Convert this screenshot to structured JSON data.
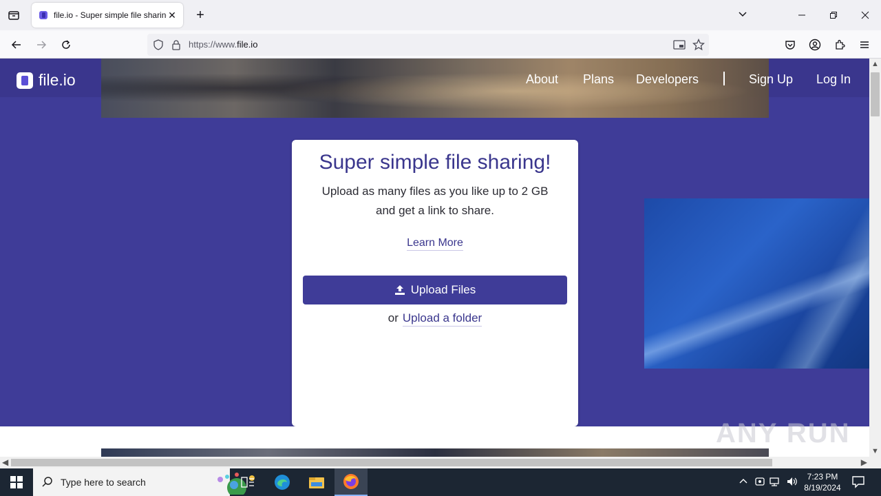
{
  "browser": {
    "tab_title": "file.io - Super simple file sharing",
    "url_prefix": "https://www.",
    "url_domain": "file.io"
  },
  "site": {
    "logo_text": "file.io",
    "nav": [
      "About",
      "Plans",
      "Developers",
      "Sign Up",
      "Log In"
    ]
  },
  "card": {
    "title": "Super simple file sharing!",
    "subtitle_line1": "Upload as many files as you like up to 2 GB",
    "subtitle_line2": "and get a link to share.",
    "learn_more": "Learn More",
    "upload_button": "Upload Files",
    "or_text": "or",
    "upload_folder": "Upload a folder"
  },
  "watermark": "ANY RUN",
  "taskbar": {
    "search_placeholder": "Type here to search",
    "time": "7:23 PM",
    "date": "8/19/2024"
  },
  "colors": {
    "brand_purple": "#3f3c98",
    "header_purple": "#3a368d"
  }
}
